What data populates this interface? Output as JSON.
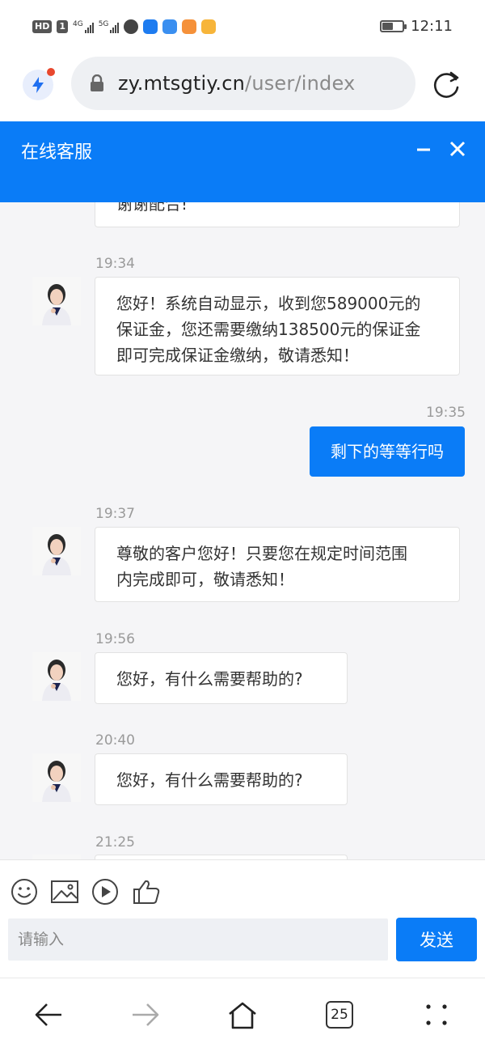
{
  "status_bar": {
    "network_tags": [
      "HD",
      "1"
    ],
    "signal1_label": "4G",
    "signal2_label": "5G",
    "time": "12:11",
    "battery_level": 0.5
  },
  "browser": {
    "url_host": "zy.mtsgtiy.cn",
    "url_path": "/user/index"
  },
  "chat": {
    "title": "在线客服",
    "partial_top": "谢谢配合!",
    "messages": [
      {
        "time": "19:34",
        "side": "in",
        "lines": [
          "您好！系统自动显示，收到您589000元的",
          "保证金，您还需要缴纳138500元的保证金",
          "即可完成保证金缴纳，敬请悉知！"
        ]
      },
      {
        "time": "19:35",
        "side": "out",
        "text": "剩下的等等行吗"
      },
      {
        "time": "19:37",
        "side": "in",
        "lines": [
          "尊敬的客户您好！只要您在规定时间范围",
          "内完成即可，敬请悉知！"
        ]
      },
      {
        "time": "19:56",
        "side": "in",
        "lines": [
          "您好，有什么需要帮助的?"
        ]
      },
      {
        "time": "20:40",
        "side": "in",
        "lines": [
          "您好，有什么需要帮助的?"
        ]
      },
      {
        "time": "21:25",
        "side": "in",
        "lines": [
          ""
        ]
      }
    ]
  },
  "input": {
    "placeholder": "请输入",
    "send_label": "发送"
  },
  "nav": {
    "tab_count": "25"
  },
  "colors": {
    "accent": "#0a7cf7",
    "background": "#f5f5f7"
  },
  "icons": [
    "lightning-icon",
    "lock-icon",
    "reload-icon",
    "minimize-icon",
    "close-icon",
    "emoji-icon",
    "image-icon",
    "play-icon",
    "thumbs-up-icon",
    "back-icon",
    "forward-icon",
    "home-icon",
    "menu-icon"
  ]
}
